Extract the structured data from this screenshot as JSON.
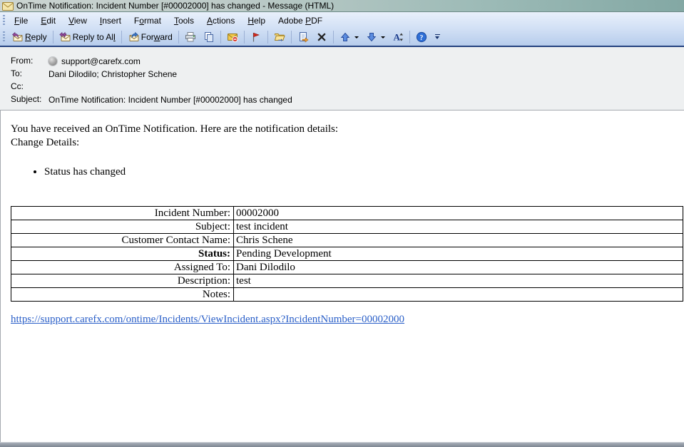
{
  "window": {
    "title": "OnTime Notification: Incident Number [#00002000] has changed - Message (HTML)"
  },
  "menu_bar": {
    "items": [
      {
        "label": "File",
        "u": 0
      },
      {
        "label": "Edit",
        "u": 0
      },
      {
        "label": "View",
        "u": 0
      },
      {
        "label": "Insert",
        "u": 0
      },
      {
        "label": "Format",
        "u": 1
      },
      {
        "label": "Tools",
        "u": 0
      },
      {
        "label": "Actions",
        "u": 0
      },
      {
        "label": "Help",
        "u": 0
      },
      {
        "label": "Adobe PDF",
        "u": 6
      }
    ]
  },
  "toolbar": {
    "buttons": [
      {
        "type": "button",
        "icon": "reply-icon",
        "label": "Reply",
        "u": 0
      },
      {
        "type": "sep"
      },
      {
        "type": "button",
        "icon": "reply-all-icon",
        "label": "Reply to All",
        "u": 11
      },
      {
        "type": "sep"
      },
      {
        "type": "button",
        "icon": "forward-icon",
        "label": "Forward",
        "u": 3
      },
      {
        "type": "sep"
      },
      {
        "type": "button",
        "icon": "print-icon"
      },
      {
        "type": "button",
        "icon": "copy-icon"
      },
      {
        "type": "sep"
      },
      {
        "type": "button",
        "icon": "block-sender-icon"
      },
      {
        "type": "sep"
      },
      {
        "type": "button",
        "icon": "flag-icon"
      },
      {
        "type": "sep"
      },
      {
        "type": "button",
        "icon": "move-to-folder-icon"
      },
      {
        "type": "sep"
      },
      {
        "type": "button",
        "icon": "create-rule-icon"
      },
      {
        "type": "button",
        "icon": "delete-icon"
      },
      {
        "type": "sep"
      },
      {
        "type": "button",
        "icon": "previous-item-icon",
        "dropdown": true
      },
      {
        "type": "button",
        "icon": "next-item-icon",
        "dropdown": true
      },
      {
        "type": "button",
        "icon": "text-size-icon"
      },
      {
        "type": "sep"
      },
      {
        "type": "button",
        "icon": "help-icon"
      }
    ]
  },
  "header": {
    "fields": [
      {
        "label": "From:",
        "value": "support@carefx.com",
        "avatar": true
      },
      {
        "label": "To:",
        "value": "Dani Dilodilo; Christopher Schene",
        "avatar": false
      },
      {
        "label": "Cc:",
        "value": "",
        "avatar": false
      },
      {
        "label": "Subject:",
        "value": "OnTime Notification: Incident Number [#00002000] has changed",
        "avatar": false
      }
    ]
  },
  "body": {
    "intro_line1": "You have received an OnTime Notification. Here are the notification details:",
    "intro_line2": "Change Details:",
    "bullets": [
      "Status has changed"
    ],
    "details_table": {
      "rows": [
        {
          "label": "Incident Number:",
          "value": "00002000",
          "bold_label": false
        },
        {
          "label": "Subject:",
          "value": "test incident",
          "bold_label": false
        },
        {
          "label": "Customer Contact Name:",
          "value": "Chris Schene",
          "bold_label": false
        },
        {
          "label": "Status:",
          "value": "Pending Development",
          "bold_label": true
        },
        {
          "label": "Assigned To:",
          "value": "Dani Dilodilo",
          "bold_label": false
        },
        {
          "label": "Description:",
          "value": "test",
          "bold_label": false
        },
        {
          "label": "Notes:",
          "value": "",
          "bold_label": false
        }
      ]
    },
    "link": "https://support.carefx.com/ontime/Incidents/ViewIncident.aspx?IncidentNumber=00002000"
  },
  "colors": {
    "link_blue": "#2a5fc8",
    "toolbar_navy_border": "#24417e",
    "titlebar_teal": "#83a8a4",
    "header_gray": "#eef0f1"
  }
}
